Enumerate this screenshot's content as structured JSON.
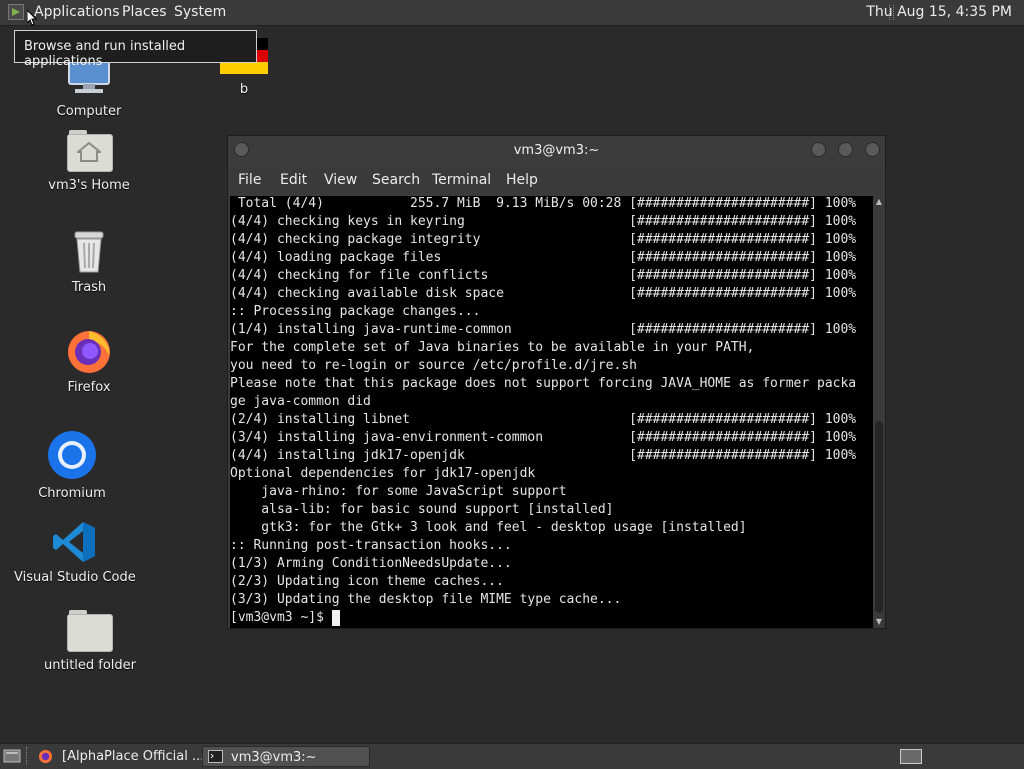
{
  "top_panel": {
    "menus": [
      "Applications",
      "Places",
      "System"
    ],
    "clock": "Thu Aug 15,  4:35 PM"
  },
  "tooltip": "Browse and run installed applications",
  "desktop": {
    "icons": [
      {
        "label": "Computer",
        "icon": "computer-icon"
      },
      {
        "label": "b",
        "icon": "image-file-icon"
      },
      {
        "label": "vm3's Home",
        "icon": "home-folder-icon"
      },
      {
        "label": "Trash",
        "icon": "trash-icon"
      },
      {
        "label": "Firefox",
        "icon": "firefox-icon"
      },
      {
        "label": "Chromium",
        "icon": "chromium-icon"
      },
      {
        "label": "Visual Studio Code",
        "icon": "vscode-icon"
      },
      {
        "label": "untitled folder",
        "icon": "folder-icon"
      }
    ]
  },
  "terminal": {
    "title": "vm3@vm3:~",
    "menu": [
      "File",
      "Edit",
      "View",
      "Search",
      "Terminal",
      "Help"
    ],
    "lines": [
      " Total (4/4)           255.7 MiB  9.13 MiB/s 00:28 [######################] 100%",
      "(4/4) checking keys in keyring                     [######################] 100%",
      "(4/4) checking package integrity                   [######################] 100%",
      "(4/4) loading package files                        [######################] 100%",
      "(4/4) checking for file conflicts                  [######################] 100%",
      "(4/4) checking available disk space                [######################] 100%",
      ":: Processing package changes...",
      "(1/4) installing java-runtime-common               [######################] 100%",
      "For the complete set of Java binaries to be available in your PATH,",
      "you need to re-login or source /etc/profile.d/jre.sh",
      "Please note that this package does not support forcing JAVA_HOME as former packa",
      "ge java-common did",
      "(2/4) installing libnet                            [######################] 100%",
      "(3/4) installing java-environment-common           [######################] 100%",
      "(4/4) installing jdk17-openjdk                     [######################] 100%",
      "Optional dependencies for jdk17-openjdk",
      "    java-rhino: for some JavaScript support",
      "    alsa-lib: for basic sound support [installed]",
      "    gtk3: for the Gtk+ 3 look and feel - desktop usage [installed]",
      ":: Running post-transaction hooks...",
      "(1/3) Arming ConditionNeedsUpdate...",
      "(2/3) Updating icon theme caches...",
      "(3/3) Updating the desktop file MIME type cache...",
      "[vm3@vm3 ~]$ "
    ]
  },
  "taskbar": {
    "tasks": [
      {
        "label": "[AlphaPlace Official ...",
        "icon": "firefox-icon",
        "active": false
      },
      {
        "label": "vm3@vm3:~",
        "icon": "terminal-icon",
        "active": true
      }
    ]
  }
}
